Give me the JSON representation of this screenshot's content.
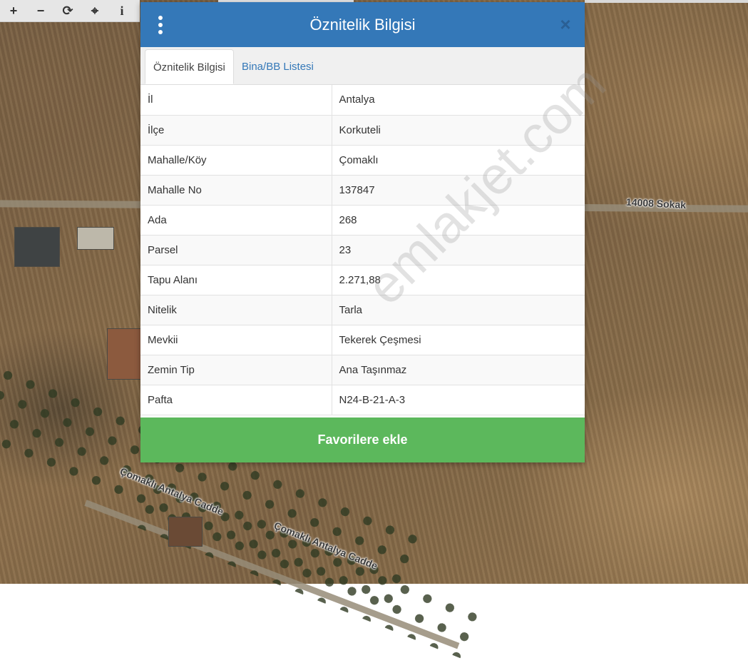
{
  "map": {
    "labels": {
      "sokak": "14008 Sokak",
      "cadde_1": "Çomaklı Antalya Cadde",
      "cadde_2": "Çomaklı Antalya Cadde"
    }
  },
  "toolbar": {
    "zoom_in_icon": "+",
    "zoom_out_icon": "−",
    "refresh_icon": "⟳",
    "locate_icon": "⌖",
    "info_icon": "i"
  },
  "dialog": {
    "title": "Öznitelik Bilgisi",
    "close_icon": "×",
    "tabs": [
      {
        "label": "Öznitelik Bilgisi",
        "active": true
      },
      {
        "label": "Bina/BB Listesi",
        "active": false
      }
    ],
    "rows": [
      {
        "key": "İl",
        "value": "Antalya"
      },
      {
        "key": "İlçe",
        "value": "Korkuteli"
      },
      {
        "key": "Mahalle/Köy",
        "value": "Çomaklı"
      },
      {
        "key": "Mahalle No",
        "value": "137847"
      },
      {
        "key": "Ada",
        "value": "268"
      },
      {
        "key": "Parsel",
        "value": "23"
      },
      {
        "key": "Tapu Alanı",
        "value": "2.271,88"
      },
      {
        "key": "Nitelik",
        "value": "Tarla"
      },
      {
        "key": "Mevkii",
        "value": "Tekerek Çeşmesi"
      },
      {
        "key": "Zemin Tip",
        "value": "Ana Taşınmaz"
      },
      {
        "key": "Pafta",
        "value": "N24-B-21-A-3"
      }
    ],
    "favorite_button": "Favorilere ekle",
    "watermark": "emlakjet.com"
  },
  "colors": {
    "header_blue": "#3478b8",
    "button_green": "#5cb85c",
    "tab_link": "#3478b8"
  }
}
